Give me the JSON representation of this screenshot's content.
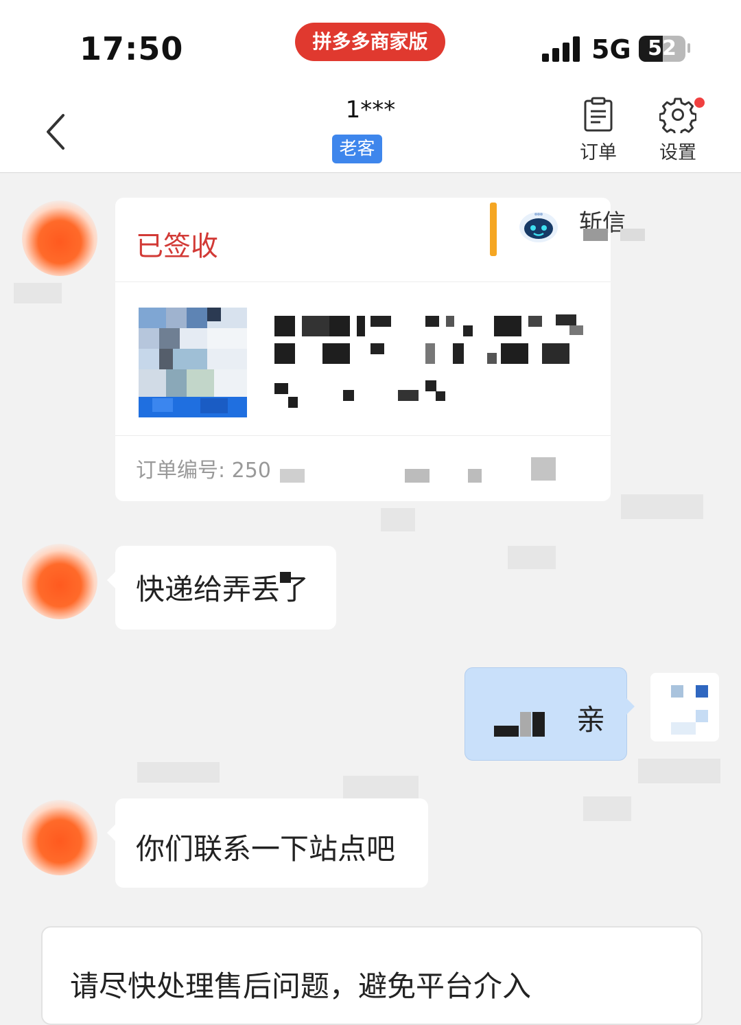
{
  "status_bar": {
    "time": "17:50",
    "app_label": "拼多多商家版",
    "network": "5G",
    "battery_level": "52",
    "battery_fraction": 0.52
  },
  "nav": {
    "back_icon": "chevron-left-icon",
    "customer_name": "1***",
    "customer_tag": "老客",
    "order_button_label": "订单",
    "settings_button_label": "设置",
    "settings_has_notification": true
  },
  "chat": {
    "order_card": {
      "status": "已签收",
      "order_number_label": "订单编号: 250",
      "bot_label": "斩信"
    },
    "messages": [
      {
        "side": "left",
        "text": "快递给弄丢了"
      },
      {
        "side": "right",
        "text": "亲"
      },
      {
        "side": "left",
        "text": "你们联系一下站点吧"
      }
    ]
  },
  "notice": {
    "text": "请尽快处理售后问题，避免平台介入"
  },
  "colors": {
    "accent_red": "#e0392f",
    "status_red": "#d23a36",
    "tag_blue": "#3e86ec",
    "my_bubble": "#c9e0fa",
    "bot_bar": "#f5a623"
  }
}
